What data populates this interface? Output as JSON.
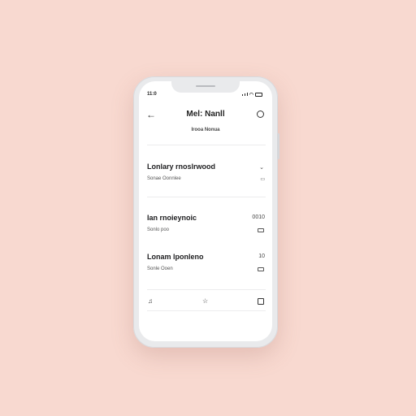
{
  "status_bar": {
    "time": "11:0"
  },
  "header": {
    "title": "Mel: Nanll",
    "subtitle": "Irooa Nonua"
  },
  "items": [
    {
      "title": "Lonlary rnoslrwood",
      "sub": "Sonae Oonnlee",
      "value": "",
      "has_chevron": true
    },
    {
      "title": "Ian rnoieynoic",
      "sub": "Sonlo poo",
      "value": "0010",
      "has_chevron": false
    },
    {
      "title": "Lonam lponleno",
      "sub": "Sonle Ooen",
      "value": "10",
      "has_chevron": false
    }
  ],
  "bottom_nav": {
    "left_icon": "music-note-icon",
    "center_icon": "star-icon",
    "right_icon": "square-icon"
  },
  "colors": {
    "background": "#f8d9d0",
    "phone_frame": "#e9eaec",
    "screen": "#ffffff"
  }
}
